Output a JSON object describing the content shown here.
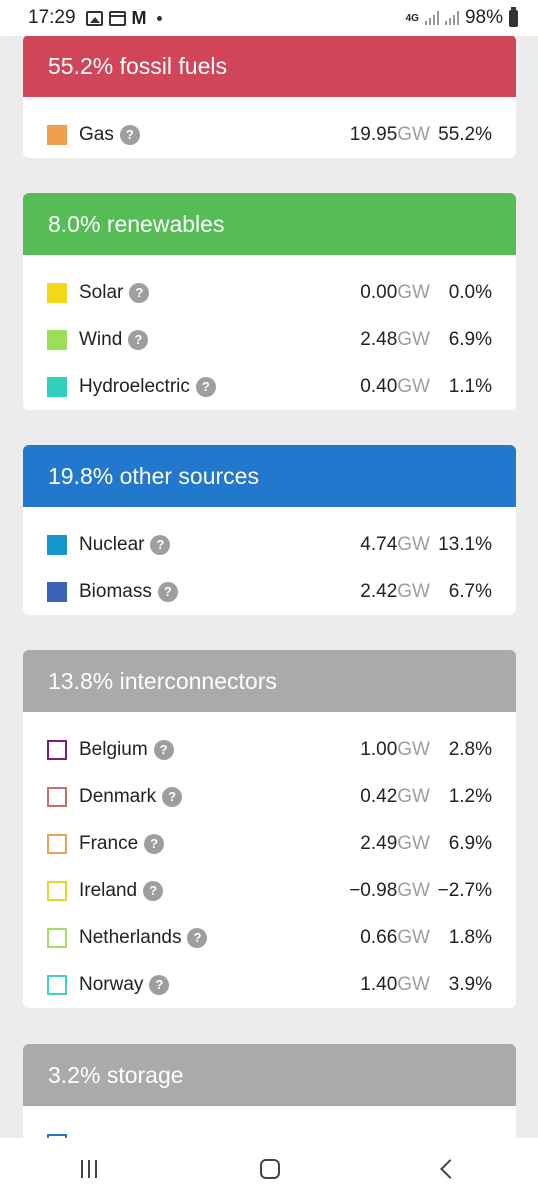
{
  "status_bar": {
    "time": "17:29",
    "network": "4G",
    "battery": "98%"
  },
  "sections": [
    {
      "title": "55.2% fossil fuels",
      "color": "#d14558",
      "rows": [
        {
          "name": "Gas",
          "swatch": "#f0a04a",
          "outline": false,
          "gw": "19.95",
          "unit": "GW",
          "pct": "55.2%"
        }
      ]
    },
    {
      "title": "8.0% renewables",
      "color": "#55bc56",
      "rows": [
        {
          "name": "Solar",
          "swatch": "#f2d816",
          "outline": false,
          "gw": "0.00",
          "unit": "GW",
          "pct": "0.0%"
        },
        {
          "name": "Wind",
          "swatch": "#9bdf58",
          "outline": false,
          "gw": "2.48",
          "unit": "GW",
          "pct": "6.9%"
        },
        {
          "name": "Hydroelectric",
          "swatch": "#2fd1bd",
          "outline": false,
          "gw": "0.40",
          "unit": "GW",
          "pct": "1.1%"
        }
      ]
    },
    {
      "title": "19.8% other sources",
      "color": "#2278cc",
      "rows": [
        {
          "name": "Nuclear",
          "swatch": "#1798cc",
          "outline": false,
          "gw": "4.74",
          "unit": "GW",
          "pct": "13.1%"
        },
        {
          "name": "Biomass",
          "swatch": "#3b62b9",
          "outline": false,
          "gw": "2.42",
          "unit": "GW",
          "pct": "6.7%"
        }
      ]
    },
    {
      "title": "13.8% interconnectors",
      "color": "#aaaaaa",
      "rows": [
        {
          "name": "Belgium",
          "swatch": "#7a1f6e",
          "outline": true,
          "gw": "1.00",
          "unit": "GW",
          "pct": "2.8%"
        },
        {
          "name": "Denmark",
          "swatch": "#c36f6a",
          "outline": true,
          "gw": "0.42",
          "unit": "GW",
          "pct": "1.2%"
        },
        {
          "name": "France",
          "swatch": "#ec9f56",
          "outline": true,
          "gw": "2.49",
          "unit": "GW",
          "pct": "6.9%"
        },
        {
          "name": "Ireland",
          "swatch": "#e5d82a",
          "outline": true,
          "gw": "−0.98",
          "unit": "GW",
          "pct": "−2.7%"
        },
        {
          "name": "Netherlands",
          "swatch": "#a5dc6a",
          "outline": true,
          "gw": "0.66",
          "unit": "GW",
          "pct": "1.8%"
        },
        {
          "name": "Norway",
          "swatch": "#47cfc0",
          "outline": true,
          "gw": "1.40",
          "unit": "GW",
          "pct": "3.9%"
        }
      ]
    },
    {
      "title": "3.2% storage",
      "color": "#aaaaaa",
      "rows": [
        {
          "name": "",
          "swatch": "#2278cc",
          "outline": true,
          "gw": "",
          "unit": "",
          "pct": ""
        }
      ]
    }
  ]
}
